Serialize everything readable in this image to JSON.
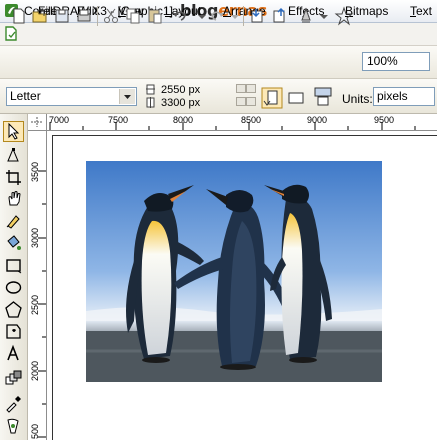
{
  "window": {
    "title": "CorelDRAW X3 - [Graphic1]"
  },
  "watermark": {
    "part1": "blog",
    "part2": "ernas"
  },
  "menu": [
    {
      "label": "File",
      "u": "F",
      "rest": "ile"
    },
    {
      "label": "Edit",
      "u": "E",
      "rest": "dit"
    },
    {
      "label": "View",
      "u": "V",
      "rest": "iew"
    },
    {
      "label": "Layout",
      "u": "L",
      "rest": "ayout"
    },
    {
      "label": "Arrange",
      "u": "A",
      "rest": "rrange"
    },
    {
      "label": "Effects",
      "pre": "Eff",
      "u": "e",
      "rest": "cts"
    },
    {
      "label": "Bitmaps",
      "u": "B",
      "rest": "itmaps"
    },
    {
      "label": "Text",
      "u": "T",
      "rest": "ext"
    }
  ],
  "toolbar": {
    "zoom": "100%"
  },
  "propbar": {
    "paper": "Letter",
    "width": "2550 px",
    "height": "3300 px",
    "units_label": "Units:",
    "units": "pixels"
  },
  "ruler": {
    "h_labels": [
      "7000",
      "7500",
      "8000",
      "8500",
      "9000",
      "9500"
    ],
    "v_labels": [
      "3500",
      "3000",
      "2500",
      "2000",
      "500"
    ]
  },
  "colors": {
    "accent": "#e1721a",
    "chrome": "#ece9d8",
    "input_border": "#7f9db9"
  }
}
